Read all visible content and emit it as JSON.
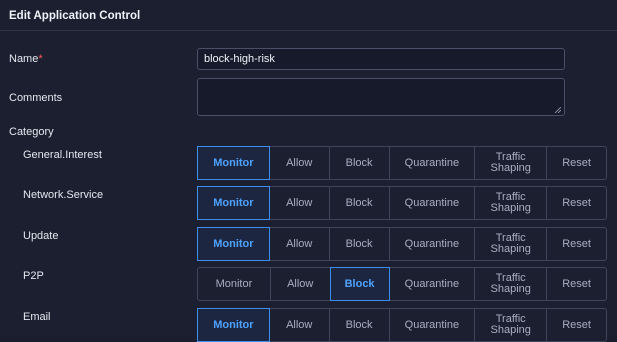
{
  "header": {
    "title": "Edit Application Control"
  },
  "form": {
    "name_label": "Name",
    "required_mark": "*",
    "name_value": "block-high-risk",
    "comments_label": "Comments",
    "comments_value": "",
    "category_label": "Category"
  },
  "action_options": [
    "Monitor",
    "Allow",
    "Block",
    "Quarantine",
    "Traffic Shaping",
    "Reset"
  ],
  "categories": [
    {
      "name": "General.Interest",
      "selected": "Monitor"
    },
    {
      "name": "Network.Service",
      "selected": "Monitor"
    },
    {
      "name": "Update",
      "selected": "Monitor"
    },
    {
      "name": "P2P",
      "selected": "Block"
    },
    {
      "name": "Email",
      "selected": "Monitor"
    }
  ],
  "colors": {
    "background": "#1b1f30",
    "accent": "#4ea3ff",
    "required": "#ff5a5a"
  }
}
